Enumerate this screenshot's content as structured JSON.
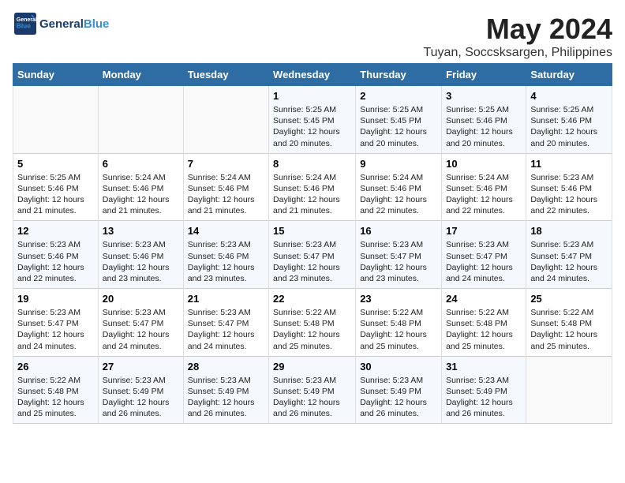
{
  "logo": {
    "line1": "General",
    "line2": "Blue"
  },
  "title": "May 2024",
  "location": "Tuyan, Soccsksargen, Philippines",
  "weekdays": [
    "Sunday",
    "Monday",
    "Tuesday",
    "Wednesday",
    "Thursday",
    "Friday",
    "Saturday"
  ],
  "weeks": [
    [
      {
        "day": "",
        "sunrise": "",
        "sunset": "",
        "daylight": ""
      },
      {
        "day": "",
        "sunrise": "",
        "sunset": "",
        "daylight": ""
      },
      {
        "day": "",
        "sunrise": "",
        "sunset": "",
        "daylight": ""
      },
      {
        "day": "1",
        "sunrise": "Sunrise: 5:25 AM",
        "sunset": "Sunset: 5:45 PM",
        "daylight": "Daylight: 12 hours and 20 minutes."
      },
      {
        "day": "2",
        "sunrise": "Sunrise: 5:25 AM",
        "sunset": "Sunset: 5:45 PM",
        "daylight": "Daylight: 12 hours and 20 minutes."
      },
      {
        "day": "3",
        "sunrise": "Sunrise: 5:25 AM",
        "sunset": "Sunset: 5:46 PM",
        "daylight": "Daylight: 12 hours and 20 minutes."
      },
      {
        "day": "4",
        "sunrise": "Sunrise: 5:25 AM",
        "sunset": "Sunset: 5:46 PM",
        "daylight": "Daylight: 12 hours and 20 minutes."
      }
    ],
    [
      {
        "day": "5",
        "sunrise": "Sunrise: 5:25 AM",
        "sunset": "Sunset: 5:46 PM",
        "daylight": "Daylight: 12 hours and 21 minutes."
      },
      {
        "day": "6",
        "sunrise": "Sunrise: 5:24 AM",
        "sunset": "Sunset: 5:46 PM",
        "daylight": "Daylight: 12 hours and 21 minutes."
      },
      {
        "day": "7",
        "sunrise": "Sunrise: 5:24 AM",
        "sunset": "Sunset: 5:46 PM",
        "daylight": "Daylight: 12 hours and 21 minutes."
      },
      {
        "day": "8",
        "sunrise": "Sunrise: 5:24 AM",
        "sunset": "Sunset: 5:46 PM",
        "daylight": "Daylight: 12 hours and 21 minutes."
      },
      {
        "day": "9",
        "sunrise": "Sunrise: 5:24 AM",
        "sunset": "Sunset: 5:46 PM",
        "daylight": "Daylight: 12 hours and 22 minutes."
      },
      {
        "day": "10",
        "sunrise": "Sunrise: 5:24 AM",
        "sunset": "Sunset: 5:46 PM",
        "daylight": "Daylight: 12 hours and 22 minutes."
      },
      {
        "day": "11",
        "sunrise": "Sunrise: 5:23 AM",
        "sunset": "Sunset: 5:46 PM",
        "daylight": "Daylight: 12 hours and 22 minutes."
      }
    ],
    [
      {
        "day": "12",
        "sunrise": "Sunrise: 5:23 AM",
        "sunset": "Sunset: 5:46 PM",
        "daylight": "Daylight: 12 hours and 22 minutes."
      },
      {
        "day": "13",
        "sunrise": "Sunrise: 5:23 AM",
        "sunset": "Sunset: 5:46 PM",
        "daylight": "Daylight: 12 hours and 23 minutes."
      },
      {
        "day": "14",
        "sunrise": "Sunrise: 5:23 AM",
        "sunset": "Sunset: 5:46 PM",
        "daylight": "Daylight: 12 hours and 23 minutes."
      },
      {
        "day": "15",
        "sunrise": "Sunrise: 5:23 AM",
        "sunset": "Sunset: 5:47 PM",
        "daylight": "Daylight: 12 hours and 23 minutes."
      },
      {
        "day": "16",
        "sunrise": "Sunrise: 5:23 AM",
        "sunset": "Sunset: 5:47 PM",
        "daylight": "Daylight: 12 hours and 23 minutes."
      },
      {
        "day": "17",
        "sunrise": "Sunrise: 5:23 AM",
        "sunset": "Sunset: 5:47 PM",
        "daylight": "Daylight: 12 hours and 24 minutes."
      },
      {
        "day": "18",
        "sunrise": "Sunrise: 5:23 AM",
        "sunset": "Sunset: 5:47 PM",
        "daylight": "Daylight: 12 hours and 24 minutes."
      }
    ],
    [
      {
        "day": "19",
        "sunrise": "Sunrise: 5:23 AM",
        "sunset": "Sunset: 5:47 PM",
        "daylight": "Daylight: 12 hours and 24 minutes."
      },
      {
        "day": "20",
        "sunrise": "Sunrise: 5:23 AM",
        "sunset": "Sunset: 5:47 PM",
        "daylight": "Daylight: 12 hours and 24 minutes."
      },
      {
        "day": "21",
        "sunrise": "Sunrise: 5:23 AM",
        "sunset": "Sunset: 5:47 PM",
        "daylight": "Daylight: 12 hours and 24 minutes."
      },
      {
        "day": "22",
        "sunrise": "Sunrise: 5:22 AM",
        "sunset": "Sunset: 5:48 PM",
        "daylight": "Daylight: 12 hours and 25 minutes."
      },
      {
        "day": "23",
        "sunrise": "Sunrise: 5:22 AM",
        "sunset": "Sunset: 5:48 PM",
        "daylight": "Daylight: 12 hours and 25 minutes."
      },
      {
        "day": "24",
        "sunrise": "Sunrise: 5:22 AM",
        "sunset": "Sunset: 5:48 PM",
        "daylight": "Daylight: 12 hours and 25 minutes."
      },
      {
        "day": "25",
        "sunrise": "Sunrise: 5:22 AM",
        "sunset": "Sunset: 5:48 PM",
        "daylight": "Daylight: 12 hours and 25 minutes."
      }
    ],
    [
      {
        "day": "26",
        "sunrise": "Sunrise: 5:22 AM",
        "sunset": "Sunset: 5:48 PM",
        "daylight": "Daylight: 12 hours and 25 minutes."
      },
      {
        "day": "27",
        "sunrise": "Sunrise: 5:23 AM",
        "sunset": "Sunset: 5:49 PM",
        "daylight": "Daylight: 12 hours and 26 minutes."
      },
      {
        "day": "28",
        "sunrise": "Sunrise: 5:23 AM",
        "sunset": "Sunset: 5:49 PM",
        "daylight": "Daylight: 12 hours and 26 minutes."
      },
      {
        "day": "29",
        "sunrise": "Sunrise: 5:23 AM",
        "sunset": "Sunset: 5:49 PM",
        "daylight": "Daylight: 12 hours and 26 minutes."
      },
      {
        "day": "30",
        "sunrise": "Sunrise: 5:23 AM",
        "sunset": "Sunset: 5:49 PM",
        "daylight": "Daylight: 12 hours and 26 minutes."
      },
      {
        "day": "31",
        "sunrise": "Sunrise: 5:23 AM",
        "sunset": "Sunset: 5:49 PM",
        "daylight": "Daylight: 12 hours and 26 minutes."
      },
      {
        "day": "",
        "sunrise": "",
        "sunset": "",
        "daylight": ""
      }
    ]
  ]
}
